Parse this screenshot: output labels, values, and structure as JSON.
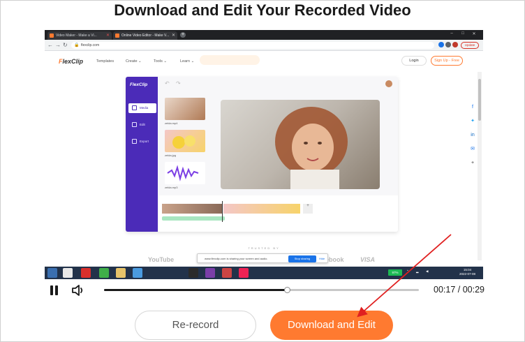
{
  "page": {
    "title": "Download and Edit Your Recorded Video"
  },
  "browser": {
    "tabs": [
      {
        "label": "Video Maker - Make a Vi..."
      },
      {
        "label": "Online Video Editor - Make V..."
      }
    ],
    "url": "flexclip.com",
    "update_label": "Update"
  },
  "site": {
    "logo_prefix": "F",
    "logo_rest": "lexClip",
    "nav": [
      "Templates",
      "Create ⌄",
      "Tools ⌄",
      "Learn ⌄"
    ],
    "login_label": "Login",
    "signup_label": "Sign Up - Free"
  },
  "editor": {
    "logo": "FlexClip",
    "sidebar": [
      {
        "label": "Media",
        "icon": "media-icon"
      },
      {
        "label": "Edit",
        "icon": "edit-icon"
      },
      {
        "label": "Export",
        "icon": "export-icon"
      }
    ],
    "media": [
      {
        "label": "zelda.mp4"
      },
      {
        "label": "zelda.jpg"
      },
      {
        "label": "zelda.mp3"
      }
    ]
  },
  "page_footer": {
    "trusted_label": "TRUSTED BY",
    "brands": [
      "YouTube",
      "ebook",
      "VISA"
    ]
  },
  "share_bar": {
    "text": "www.flexclip.com is sharing your screen and audio.",
    "stop_label": "Stop sharing",
    "hide_label": "Hide"
  },
  "taskbar": {
    "battery": "97%",
    "clock_time": "15:04",
    "clock_date": "2022-07-08"
  },
  "player": {
    "current_time": "00:17",
    "duration": "00:29",
    "time_display": "00:17 / 00:29",
    "progress_fraction": 0.58,
    "pause_icon": "pause-icon",
    "volume_icon": "volume-icon"
  },
  "actions": {
    "rerecord_label": "Re-record",
    "download_label": "Download and Edit"
  },
  "colors": {
    "accent": "#ff7a30",
    "editor_sidebar": "#4b2bb8",
    "arrow": "#e02020"
  }
}
